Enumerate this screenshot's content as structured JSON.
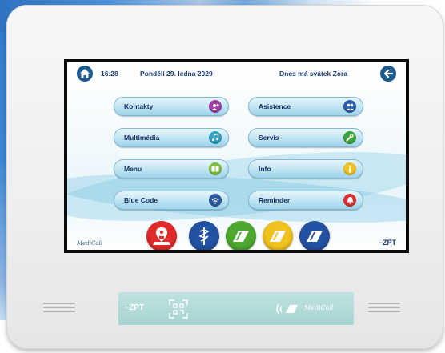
{
  "statusbar": {
    "time": "16:28",
    "date": "Pondělí 29. ledna 2029",
    "nameday": "Dnes má svátek Zora"
  },
  "menu": [
    {
      "label": "Kontakty",
      "icon": "people-icon",
      "color": "#a23ea6"
    },
    {
      "label": "Asistence",
      "icon": "assistance-icon",
      "color": "#2e5fae"
    },
    {
      "label": "Multimédia",
      "icon": "music-icon",
      "color": "#2aa4c7"
    },
    {
      "label": "Servis",
      "icon": "wrench-icon",
      "color": "#3aa43a"
    },
    {
      "label": "Menu",
      "icon": "book-icon",
      "color": "#7cbf3a"
    },
    {
      "label": "Info",
      "icon": "info-icon",
      "color": "#f1c21e"
    },
    {
      "label": "Blue Code",
      "icon": "wifi-icon",
      "color": "#2d5aa7"
    },
    {
      "label": "Reminder",
      "icon": "bell-icon",
      "color": "#e03030"
    }
  ],
  "quick_buttons": [
    {
      "name": "location",
      "color": "#e12b2b"
    },
    {
      "name": "medical",
      "color": "#2452a3"
    },
    {
      "name": "call-green",
      "color": "#4da82f"
    },
    {
      "name": "call-yellow",
      "color": "#f1c21e"
    },
    {
      "name": "call-blue",
      "color": "#2452a3"
    }
  ],
  "screen_brand": {
    "left": "MediCall",
    "right": "ZPT"
  },
  "panel": {
    "zpt": "ZPT",
    "medicall": "MediCall"
  }
}
